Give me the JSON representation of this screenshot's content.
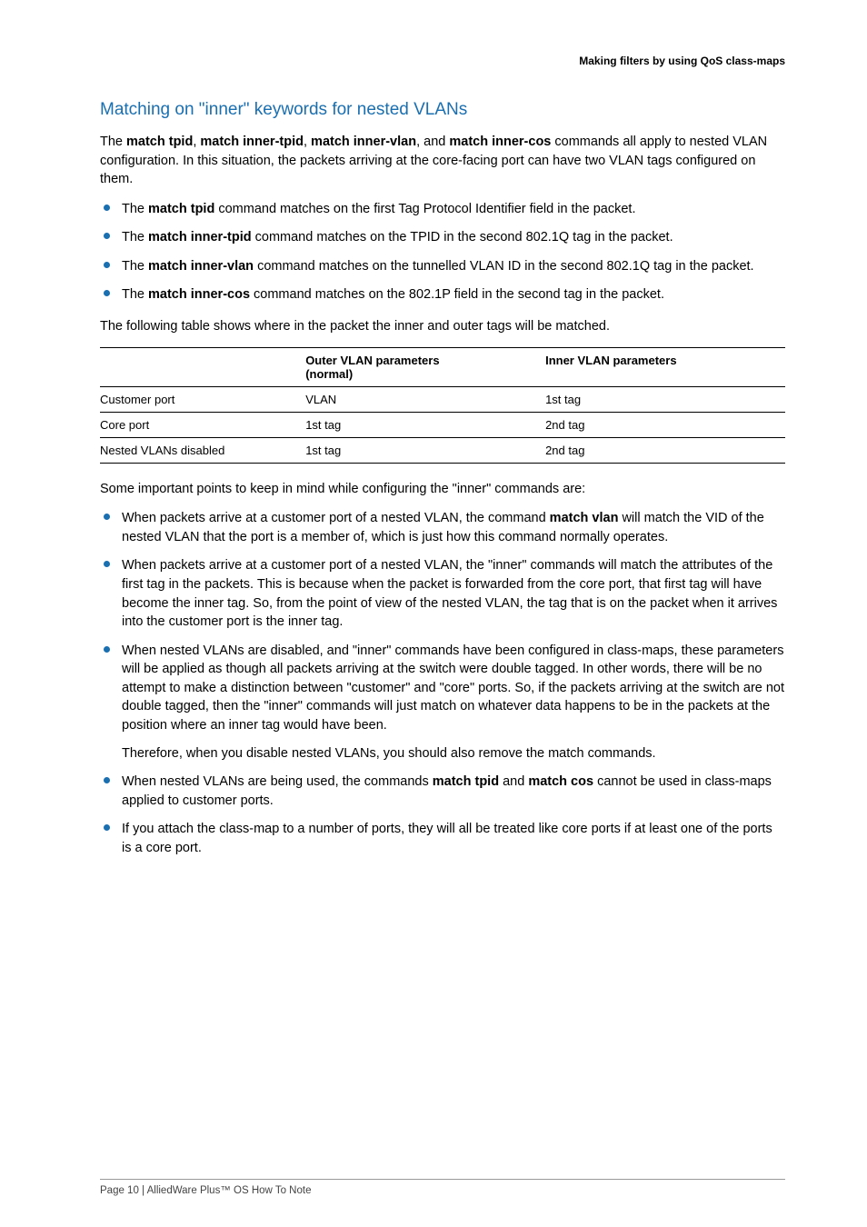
{
  "header": {
    "running": "Making filters by using QoS class-maps"
  },
  "section": {
    "title": "Matching on \"inner\" keywords for nested VLANs"
  },
  "intro": {
    "p1a": "The ",
    "k1": "match tpid",
    "sep1": ", ",
    "k2": "match inner-tpid",
    "sep2": ", ",
    "k3": "match inner-vlan",
    "sep3": ", and ",
    "k4": "match inner-cos",
    "p1b": " commands all apply to nested VLAN configuration. In this situation, the packets arriving at the core-facing port can have two VLAN tags configured on them."
  },
  "bullets1": [
    {
      "pre": "The ",
      "kw": "match tpid",
      "post": " command matches on the first Tag Protocol Identifier field in the packet."
    },
    {
      "pre": "The ",
      "kw": "match inner-tpid",
      "post": " command matches on the TPID in the second 802.1Q tag in the packet."
    },
    {
      "pre": "The ",
      "kw": "match inner-vlan",
      "post": " command matches on the tunnelled VLAN ID in the second 802.1Q tag in the packet."
    },
    {
      "pre": "The ",
      "kw": "match inner-cos",
      "post": " command matches on the 802.1P field in the second tag in the packet."
    }
  ],
  "tableIntro": "The following table shows where in the packet the inner and outer tags will be matched.",
  "table": {
    "h1": "",
    "h2a": "Outer VLAN parameters",
    "h2b": "(normal)",
    "h3": "Inner VLAN parameters",
    "rows": [
      {
        "c1": "Customer port",
        "c2": "VLAN",
        "c3": "1st tag"
      },
      {
        "c1": "Core port",
        "c2": "1st tag",
        "c3": "2nd tag"
      },
      {
        "c1": "Nested VLANs disabled",
        "c2": "1st tag",
        "c3": "2nd tag"
      }
    ]
  },
  "afterTable": "Some important points to keep in mind while configuring the \"inner\" commands are:",
  "bullets2": {
    "i0": {
      "pre": "When packets arrive at a customer port of a nested VLAN, the command ",
      "kw": "match vlan",
      "post": " will match the VID of the nested VLAN that the port is a member of, which is just how this command normally operates."
    },
    "i1": {
      "text": "When packets arrive at a customer port of a nested VLAN, the \"inner\" commands will match the attributes of the first tag in the packets. This is because when the packet is forwarded from the core port, that first tag will have become the inner tag. So, from the point of view of the nested VLAN, the tag that is on the packet when it arrives into the customer port is the inner tag."
    },
    "i2": {
      "text": "When nested VLANs are disabled, and \"inner\" commands have been configured in class-maps, these parameters will be applied as though all packets arriving at the switch were double tagged. In other words, there will be no attempt to make a distinction between \"customer\" and \"core\" ports. So, if the packets arriving at the switch are not double tagged, then the \"inner\" commands will just match on whatever data happens to be in the packets at the position where an inner tag would have been.",
      "sub": "Therefore, when you disable nested VLANs, you should also remove the match commands."
    },
    "i3": {
      "pre": "When nested VLANs are being used, the commands ",
      "kw1": "match tpid",
      "mid": " and ",
      "kw2": "match cos",
      "post": " cannot be used in class-maps applied to customer ports."
    },
    "i4": {
      "text": "If you attach the class-map to a number of ports, they will all be treated like core ports if at least one of the ports is a core port."
    }
  },
  "footer": {
    "text": "Page 10 | AlliedWare Plus™ OS How To Note"
  }
}
